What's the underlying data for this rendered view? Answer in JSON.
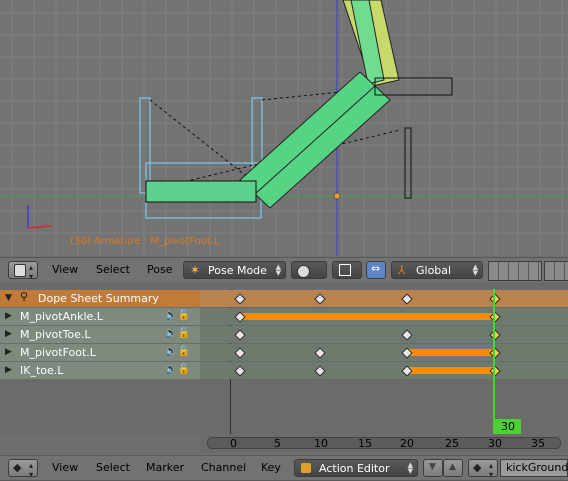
{
  "viewport": {
    "object_label": "(30) Armature : M_pivotFoot.L"
  },
  "view3d_header": {
    "menus": [
      "View",
      "Select",
      "Pose"
    ],
    "mode": "Pose Mode",
    "orientation": "Global"
  },
  "dope_sheet": {
    "channels": [
      {
        "label": "Dope Sheet Summary",
        "kind": "summary"
      },
      {
        "label": "M_pivotAnkle.L",
        "kind": "group"
      },
      {
        "label": "M_pivotToe.L",
        "kind": "group"
      },
      {
        "label": "M_pivotFoot.L",
        "kind": "group"
      },
      {
        "label": "IK_toe.L",
        "kind": "group"
      }
    ],
    "current_frame": "30",
    "ruler_ticks": [
      "0",
      "5",
      "10",
      "15",
      "20",
      "25",
      "30",
      "35"
    ]
  },
  "dopesheet_header": {
    "menus": [
      "View",
      "Select",
      "Marker",
      "Channel",
      "Key"
    ],
    "editor_mode": "Action Editor",
    "action_name": "kickGround"
  },
  "colors": {
    "keyframe_bar": "#ff8c00",
    "current_frame": "#4ecf35",
    "summary_row": "#c07a3a",
    "label_text": "#e07a1c"
  }
}
